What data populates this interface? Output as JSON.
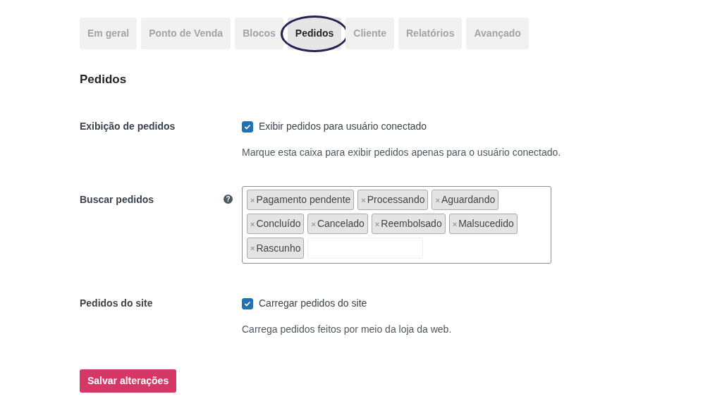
{
  "tabs": [
    {
      "label": "Em geral",
      "selected": false,
      "circled": false
    },
    {
      "label": "Ponto de Venda",
      "selected": false,
      "circled": false
    },
    {
      "label": "Blocos",
      "selected": false,
      "circled": false
    },
    {
      "label": "Pedidos",
      "selected": true,
      "circled": true
    },
    {
      "label": "Cliente",
      "selected": false,
      "circled": false
    },
    {
      "label": "Relatórios",
      "selected": false,
      "circled": false
    },
    {
      "label": "Avançado",
      "selected": false,
      "circled": false
    }
  ],
  "section_title": "Pedidos",
  "settings": [
    {
      "kind": "checkbox",
      "label": "Exibição de pedidos",
      "checked": true,
      "option": "Exibir pedidos para usuário conectado",
      "description": "Marque esta caixa para exibir pedidos apenas para o usuário conectado."
    },
    {
      "kind": "tags",
      "label": "Buscar pedidos",
      "help": "?",
      "remove_symbol": "×",
      "tags": [
        "Pagamento pendente",
        "Processando",
        "Aguardando",
        "Concluído",
        "Cancelado",
        "Reembolsado",
        "Malsucedido",
        "Rascunho"
      ]
    },
    {
      "kind": "checkbox",
      "label": "Pedidos do site",
      "checked": true,
      "option": "Carregar pedidos do site",
      "description": "Carrega pedidos feitos por meio da loja da web."
    }
  ],
  "save_button": "Salvar alterações"
}
